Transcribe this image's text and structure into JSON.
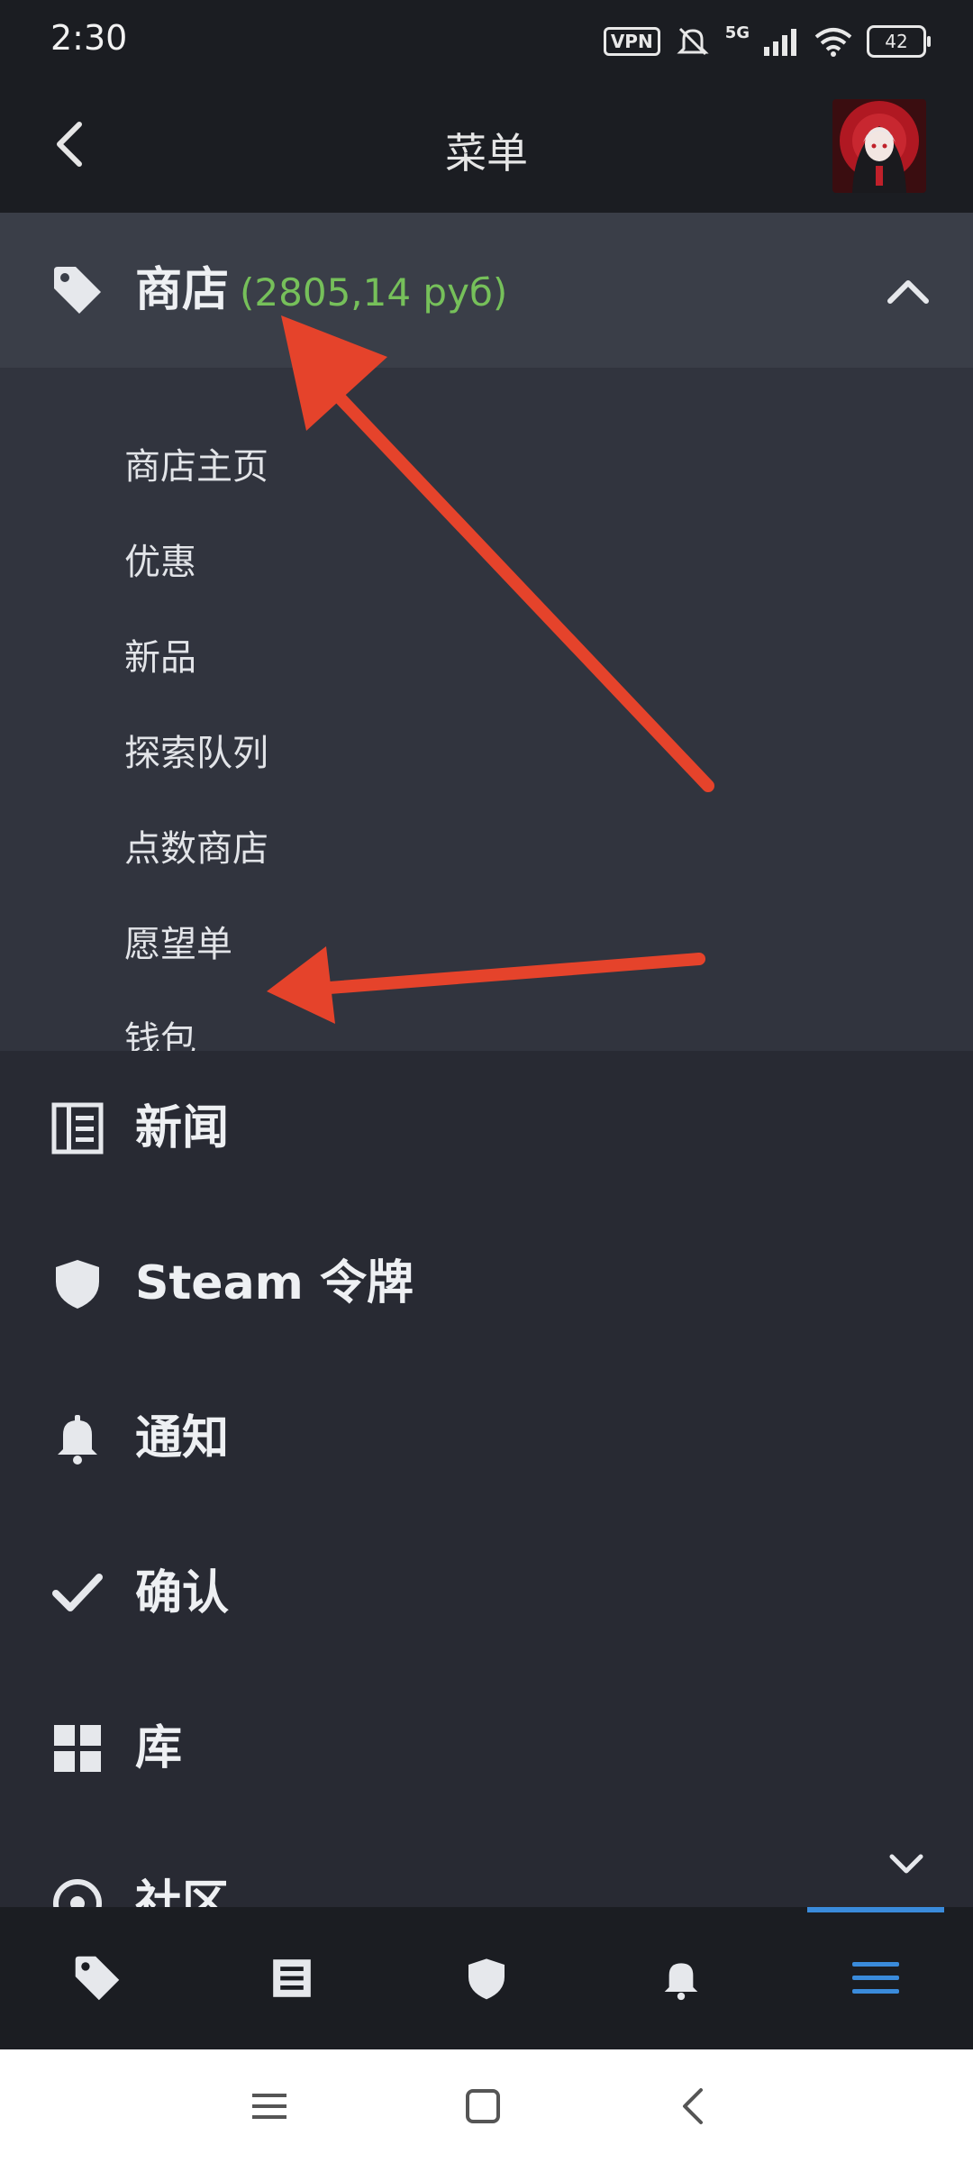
{
  "status_bar": {
    "time": "2:30",
    "vpn": "VPN",
    "network": "5G",
    "battery": "42"
  },
  "header": {
    "title": "菜单"
  },
  "store": {
    "label": "商店",
    "balance": "(2805,14 руб)",
    "items": [
      "商店主页",
      "优惠",
      "新品",
      "探索队列",
      "点数商店",
      "愿望单",
      "钱包"
    ]
  },
  "sections": [
    {
      "label": "新闻",
      "icon": "news-icon"
    },
    {
      "label": "Steam 令牌",
      "icon": "shield-icon"
    },
    {
      "label": "通知",
      "icon": "bell-icon"
    },
    {
      "label": "确认",
      "icon": "check-icon"
    },
    {
      "label": "库",
      "icon": "grid-icon"
    },
    {
      "label": "社区",
      "icon": "community-icon"
    }
  ],
  "bottom_nav": [
    "tag-icon",
    "news-icon",
    "shield-icon",
    "bell-icon",
    "menu-icon"
  ],
  "colors": {
    "accent": "#3a8bdb",
    "balance": "#76c05a",
    "annotation_arrow": "#e5432b"
  }
}
